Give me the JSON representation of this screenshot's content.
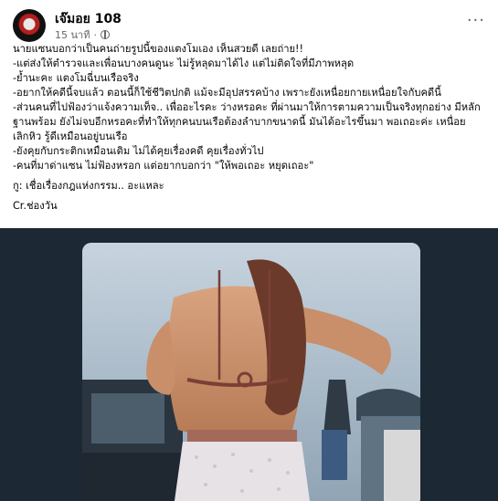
{
  "post": {
    "author": "เจ๊มอย 108",
    "time": "15 นาที",
    "privacy_icon": "globe-icon",
    "more_icon": "more-options-icon",
    "lines": [
      "นายแซนบอกว่าเป็นคนถ่ายรูปนี้ของแตงโมเอง เห็นสวยดี เลยถ่าย!!",
      "-แต่ส่งให้ตำรวจและเพื่อนบางคนดูนะ ไม่รู้หลุดมาได้ไง แต่ไม่ติดใจที่มีภาพหลุด",
      "-ย้ำนะคะ แตงโมฉี่บนเรือจริง",
      "-อยากให้คดีนี้จบแล้ว ตอนนี้ก็ใช้ชีวิตปกติ แม้จะมีอุปสรรคบ้าง เพราะยังเหนื่อยกายเหนื่อยใจกับคดีนี้",
      "-ส่วนคนที่ไปฟ้องว่าแจ้งความเท็จ.. เพื่ออะไรคะ ว่างหรอคะ ที่ผ่านมาให้การตามความเป็นจริงทุกอย่าง มีหลัก",
      "ฐานพร้อม ยังไม่จบอีกหรอคะที่ทำให้ทุกคนบนเรือต้องลำบากขนาดนี้ มันได้อะไรขึ้นมา พอเถอะค่ะ เหนื่อย",
      "เลิกหิว รู้ดีเหมือนอยู่บนเรือ",
      "-ยังคุยกับกระติกเหมือนเดิม ไม่ได้คุยเรื่องคดี คุยเรื่องทั่วไป",
      "-คนที่มาด่าแซน ไม่ฟ้องหรอก แต่อยากบอกว่า \"ให้พอเถอะ หยุดเถอะ\""
    ],
    "footnote": "กู: เชื่อเรื่องกฎแห่งกรรม.. อะแหละ",
    "credit": "Cr.ช่องวัน"
  }
}
